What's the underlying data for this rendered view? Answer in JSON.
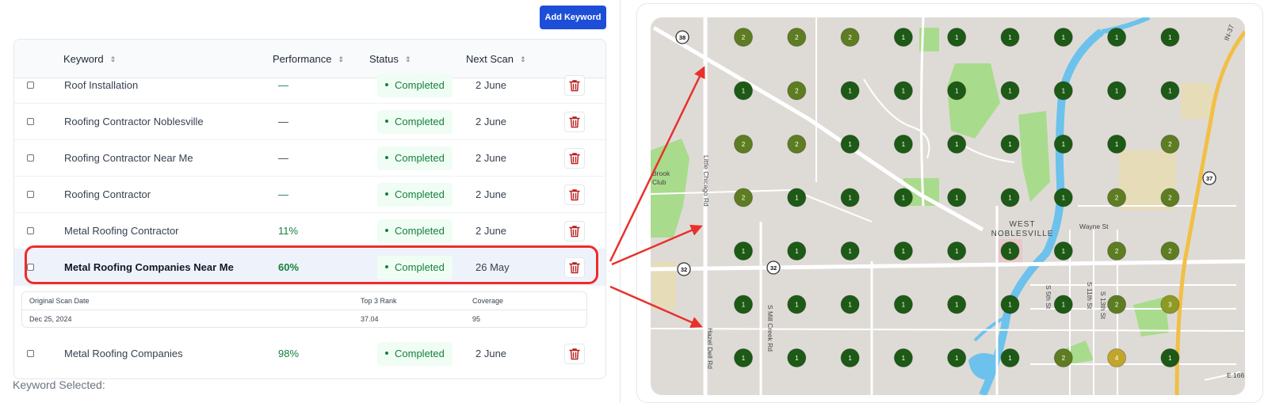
{
  "toolbar": {
    "add_keyword_label": "Add Keyword"
  },
  "table": {
    "headers": {
      "keyword": "Keyword",
      "performance": "Performance",
      "status": "Status",
      "next_scan": "Next Scan"
    },
    "rows": [
      {
        "keyword": "Roof Installation",
        "performance": "—",
        "status": "Completed",
        "next_scan": "2 June"
      },
      {
        "keyword": "Roofing Contractor Noblesville",
        "performance": "—",
        "status": "Completed",
        "next_scan": "2 June"
      },
      {
        "keyword": "Roofing Contractor Near Me",
        "performance": "—",
        "status": "Completed",
        "next_scan": "2 June"
      },
      {
        "keyword": "Roofing Contractor",
        "performance": "—",
        "status": "Completed",
        "next_scan": "2 June"
      },
      {
        "keyword": "Metal Roofing Contractor",
        "performance": "11%",
        "status": "Completed",
        "next_scan": "2 June"
      },
      {
        "keyword": "Metal Roofing Companies Near Me",
        "performance": "60%",
        "status": "Completed",
        "next_scan": "26 May"
      },
      {
        "keyword": "Metal Roofing Companies",
        "performance": "98%",
        "status": "Completed",
        "next_scan": "2 June"
      }
    ],
    "detail": {
      "headers": [
        "Original Scan Date",
        "Top 3 Rank",
        "Coverage"
      ],
      "values": [
        "Dec 25, 2024",
        "37.04",
        "95"
      ]
    }
  },
  "footer": {
    "keyword_selected_label": "Keyword Selected:"
  },
  "map": {
    "labels": {
      "west_noblesville_line1": "WEST",
      "west_noblesville_line2": "NOBLESVILLE",
      "wayne_st": "Wayne St",
      "little_chicago_rd": "Little Chicago Rd",
      "hazel_dell_rd": "Hazel Dell Rd",
      "s_mill_creek_rd": "S Mill Creek Rd",
      "s_5th_st": "S 5th St",
      "s_11th_st": "S 11th St",
      "s_13th_st": "S 13th St",
      "e_166": "E 166",
      "in_37": "IN-37",
      "brook_club_line1": "Brook",
      "brook_club_line2": "Club",
      "shield_38": "38",
      "shield_32a": "32",
      "shield_32b": "32",
      "shield_37": "37"
    },
    "grid_ranks": [
      [
        "2",
        "2",
        "2",
        "1",
        "1",
        "1",
        "1",
        "1",
        "1"
      ],
      [
        "1",
        "2",
        "1",
        "1",
        "1",
        "1",
        "1",
        "1",
        "1"
      ],
      [
        "2",
        "2",
        "1",
        "1",
        "1",
        "1",
        "1",
        "1",
        "2"
      ],
      [
        "2",
        "1",
        "1",
        "1",
        "1",
        "1",
        "1",
        "2",
        "2"
      ],
      [
        "1",
        "1",
        "1",
        "1",
        "1",
        "1",
        "1",
        "2",
        "2"
      ],
      [
        "1",
        "1",
        "1",
        "1",
        "1",
        "1",
        "1",
        "2",
        "3"
      ],
      [
        "1",
        "1",
        "1",
        "1",
        "1",
        "1",
        "2",
        "4",
        "1"
      ]
    ],
    "rank_colors": {
      "1": "#1d5a16",
      "2": "#5e7d22",
      "3": "#8e9a24",
      "4": "#c2a62c"
    },
    "colors": {
      "map_bg": "#dedbd7",
      "park": "#a9db8c",
      "water": "#6cc2ec",
      "highway": "#f2bf45",
      "arrow": "#e8312b"
    }
  }
}
